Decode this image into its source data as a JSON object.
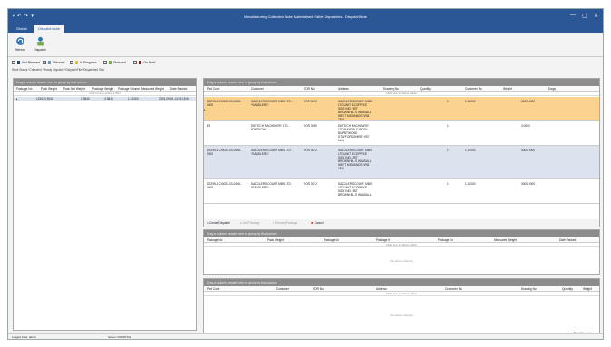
{
  "title_bar": {
    "quick_access": "▪ ↶ ↷ ▾",
    "title": "Manufacturing Collection Note Materialised Pallet Dispatches - DispatchNote",
    "min": "—",
    "max": "▢",
    "close": "✕"
  },
  "tabs": [
    "Global",
    "DispatchNote"
  ],
  "ribbon": {
    "refresh": "Refresh",
    "dispatch": "Dispatch"
  },
  "filters": [
    {
      "label": "Not Planned",
      "checked": true,
      "color": "#1f4e79"
    },
    {
      "label": "Planned",
      "checked": true,
      "color": "#5b9bd5"
    },
    {
      "label": "In Progress",
      "checked": true,
      "color": "#ffc000"
    },
    {
      "label": "Finished",
      "checked": false,
      "color": "#70ad47"
    },
    {
      "label": "On Hold",
      "checked": false,
      "color": "#c00000"
    }
  ],
  "crumbs": "Work Status  *Collected  *Ready Dispatch  *DispatchFile  *Dispatched Stat",
  "left_panel": {
    "header": "Drag a column header here to group by that column",
    "columns": [
      "Package No",
      "Pack Weight",
      "Pack Net Weight",
      "Package Weight",
      "Package Volume",
      "Measured Weight",
      "Date Packed"
    ],
    "filter_hint": "Click here to define a filter",
    "row": [
      "123473 3940",
      "",
      "1 3840",
      "4 3840",
      "1.12000",
      "",
      "2025-09-04 13:23:16:54"
    ]
  },
  "main_panel": {
    "header": "Drag a column header here to group by that column",
    "columns": [
      "Part Code",
      "Customer",
      "SOR No",
      "Address",
      "Drawing No",
      "Quantity",
      "Customer No",
      "Weight",
      "Dwgs"
    ],
    "filter_hint": "Click here to define a filter",
    "rows": [
      {
        "part": "DS295-A CI0023-03-D060-0000",
        "customer": "SADDLERS COURT MBS LTD - *SADDLERS*",
        "sor": "SOR 3072",
        "address": "SADDLERS COURT MBS LTD UNIT 5 COPPICE SIDE IND. EST BROWNHILLS WALSALL WEST MIDLANDS WS8 7EX",
        "qty": "1",
        "cust": "1.10000",
        "weight": "3000.0000",
        "bg": "#fbd38f"
      },
      {
        "part": "ES",
        "customer": "DIETECH MACHINERY LTD - *DIETECH*",
        "sor": "SOR 3090",
        "address": "DIETECH MACHINERY LTD MAYFIELD ROAD BURNTWOOD STAFFORDSHIRE WS7 1LN",
        "qty": "1",
        "cust": "",
        "weight": "3.0000",
        "bg": "#ffffff"
      },
      {
        "part": "DS295-A CI0023-03-D060-0000",
        "customer": "SADDLERS COURT MBS LTD - *SADDLERS*",
        "sor": "SOR 3072",
        "address": "SADDLERS COURT MBS LTD UNIT 5 COPPICE SIDE IND. EST BROWNHILLS WALSALL WEST MIDLANDS WS8 7EX",
        "qty": "1",
        "cust": "1.10000",
        "weight": "3000.0000",
        "bg": "#dde3ee"
      },
      {
        "part": "DS295-A CI0023-03-D060-0000",
        "customer": "SADDLERS COURT MBS LTD - *SADDLERS*",
        "sor": "SOR 3072",
        "address": "SADDLERS COURT MBS LTD UNIT 5 COPPICE SIDE IND. EST BROWNHILLS WALSALL",
        "qty": "1",
        "cust": "1.10000",
        "weight": "3000.0000",
        "bg": "#ffffff"
      }
    ]
  },
  "main_buttons": [
    "Create Dispatch",
    "Add Package",
    "Remove Package",
    "Cancel"
  ],
  "panel2": {
    "header": "Drag a column header here to group by that column",
    "columns": [
      "Package No",
      "Pack Weight",
      "Package Vo",
      "Package It",
      "Package Vo",
      "Measured Weight",
      "Date Packed"
    ],
    "filter_hint": "Click here to define a filter",
    "empty": "<No data to display>"
  },
  "panel3": {
    "header": "Drag a column header here to group by that column",
    "columns": [
      "Part Code",
      "Customer",
      "SOR No",
      "Address",
      "Customer No",
      "Drawing No",
      "Quantity",
      "Weight"
    ],
    "filter_hint": "Click here to define a filter",
    "empty": "<No data to display>"
  },
  "bottom_button": "Print Dispatch",
  "status": {
    "left": "Logged in as: admin",
    "mid": "Server: DISPATCH"
  }
}
